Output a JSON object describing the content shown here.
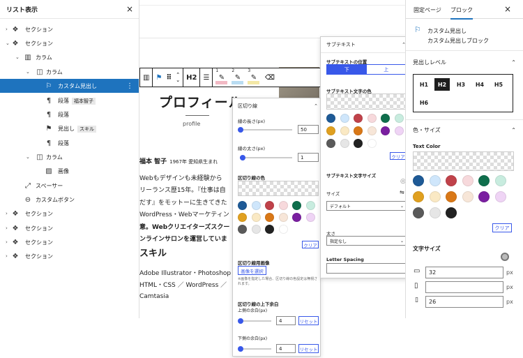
{
  "list_view": {
    "title": "リスト表示",
    "close": "×",
    "items": [
      {
        "label": "セクション",
        "tag": ""
      },
      {
        "label": "セクション",
        "tag": ""
      },
      {
        "label": "カラム",
        "tag": ""
      },
      {
        "label": "カラム",
        "tag": ""
      },
      {
        "label": "カスタム見出し",
        "tag": ""
      },
      {
        "label": "段落",
        "tag": "福本智子"
      },
      {
        "label": "段落",
        "tag": ""
      },
      {
        "label": "見出し",
        "tag": "スキル"
      },
      {
        "label": "段落",
        "tag": ""
      },
      {
        "label": "カラム",
        "tag": ""
      },
      {
        "label": "画像",
        "tag": ""
      },
      {
        "label": "スペーサー",
        "tag": ""
      },
      {
        "label": "カスタムボタン",
        "tag": ""
      },
      {
        "label": "セクション",
        "tag": ""
      },
      {
        "label": "セクション",
        "tag": ""
      },
      {
        "label": "セクション",
        "tag": ""
      },
      {
        "label": "セクション",
        "tag": ""
      }
    ]
  },
  "toolbar": {
    "h2": "H2",
    "pens": [
      "1",
      "2",
      "3"
    ]
  },
  "canvas": {
    "title": "プロフィール",
    "subtitle": "profile",
    "name": "福本 智子",
    "name_meta": "1967年 愛知県生まれ",
    "body_lines": [
      "Webもデザインも未経験から",
      "リーランス歴15年。『仕事は自",
      "だす』をモットーに生きてきた",
      "WordPress・Webマーケティン",
      "意。Webクリエイターズスクー",
      "ンラインサロンを運営していま"
    ],
    "skill_heading": "スキル",
    "skill_lines": [
      "Adobe Illustrator・Photoshop ／",
      "HTML・CSS ／ WordPress ／",
      "Camtasia"
    ]
  },
  "divider_panel": {
    "title": "区切り線",
    "length_label": "線の長さ(px)",
    "length_value": "50",
    "thickness_label": "線の太さ(px)",
    "thickness_value": "1",
    "color_label": "区切り線の色",
    "clear": "クリア",
    "image_label": "区切り線用画像",
    "image_button": "画像を選択",
    "image_note": "※画像を指定した場合、区切り線の色設定は無視されます。",
    "margin_label": "区切り線の上下余白",
    "top_label": "上側の余白(px)",
    "top_value": "4",
    "bottom_label": "下側の余白(px)",
    "bottom_value": "4",
    "reset": "リセット"
  },
  "subtext_panel": {
    "title": "サブテキスト",
    "position_label": "サブテキストの位置",
    "pos_bottom": "下",
    "pos_top": "上",
    "color_label": "サブテキスト文字の色",
    "clear": "クリア",
    "size_label": "サブテキスト文字サイズ",
    "size_sub": "サイズ",
    "size_value": "デフォルト",
    "weight_label": "太さ",
    "weight_value": "指定なし",
    "spacing_label": "Letter Spacing"
  },
  "sidebar": {
    "tab_page": "固定ページ",
    "tab_block": "ブロック",
    "close": "×",
    "block_name": "カスタム見出し",
    "block_desc": "カスタム見出しブロック",
    "heading_level_label": "見出しレベル",
    "levels": [
      "H1",
      "H2",
      "H3",
      "H4",
      "H5",
      "H6"
    ],
    "color_size_label": "色・サイズ",
    "text_color_label": "Text Color",
    "clear": "クリア",
    "font_size_label": "文字サイズ",
    "size_desktop": "32",
    "size_tablet": "",
    "size_mobile": "26",
    "unit": "px"
  },
  "palette": [
    "#1e5a96",
    "#cfe6fb",
    "#c0424a",
    "#f7d9dc",
    "#0f6e4c",
    "#c8ecdf",
    "#e0a020",
    "#fae9c4",
    "#d97817",
    "#f7e6d8",
    "#7a1fa0",
    "#efd4f5",
    "#5a5a5a",
    "#e6e6e6",
    "#222222",
    "#ffffff"
  ],
  "pen_colors": [
    "#f2b9c4",
    "#b9dcf2",
    "#f4e8a6"
  ]
}
